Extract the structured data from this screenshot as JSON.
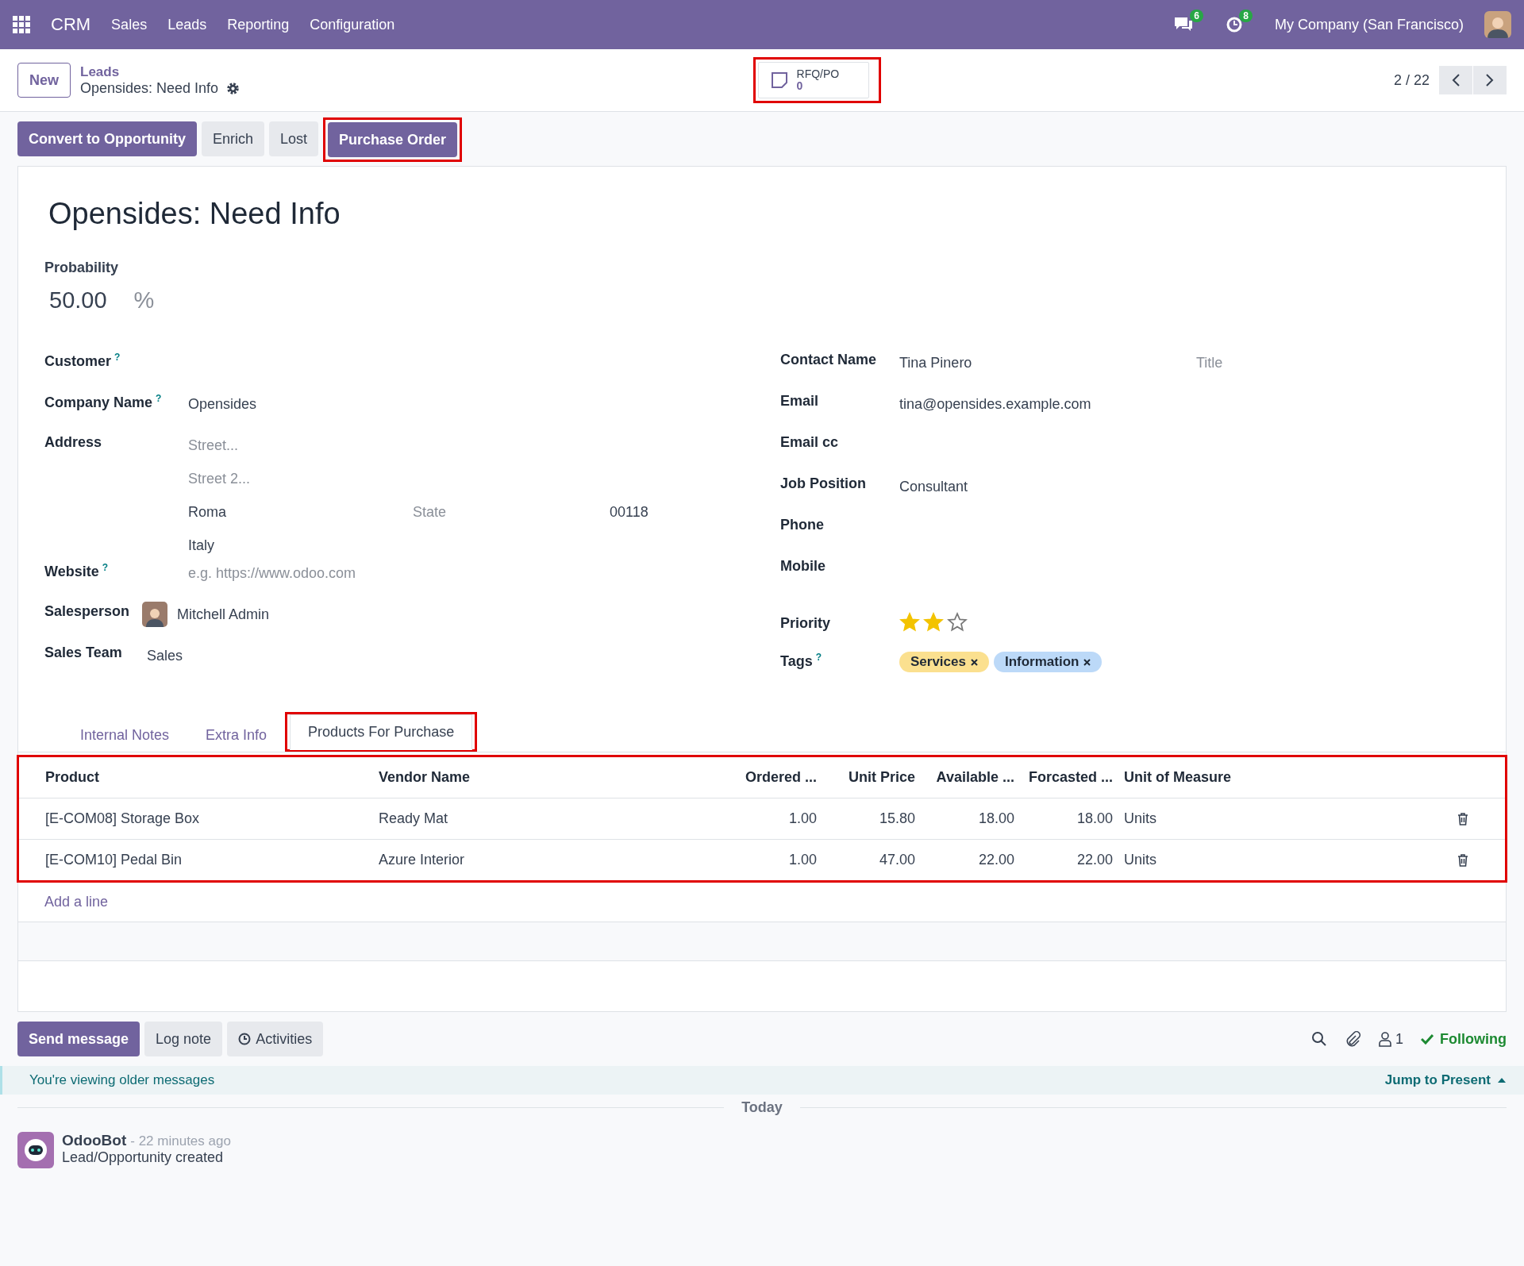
{
  "navbar": {
    "app": "CRM",
    "menus": [
      "Sales",
      "Leads",
      "Reporting",
      "Configuration"
    ],
    "messages_count": "6",
    "activities_count": "8",
    "company": "My Company (San Francisco)"
  },
  "control_panel": {
    "new_button": "New",
    "breadcrumb": "Leads",
    "record": "Opensides: Need Info",
    "smart_button": {
      "label": "RFQ/PO",
      "value": "0",
      "highlighted": true
    },
    "pager": "2 / 22"
  },
  "actions": [
    {
      "label": "Convert to Opportunity",
      "primary": true,
      "highlighted": false
    },
    {
      "label": "Enrich",
      "primary": false,
      "highlighted": false
    },
    {
      "label": "Lost",
      "primary": false,
      "highlighted": false
    },
    {
      "label": "Purchase Order",
      "primary": true,
      "highlighted": true
    }
  ],
  "form": {
    "title": "Opensides: Need Info",
    "probability": {
      "label": "Probability",
      "value": "50.00",
      "unit": "%"
    },
    "left_fields": [
      {
        "kind": "text",
        "label": "Customer",
        "help": "?"
      },
      {
        "kind": "text",
        "label": "Company Name",
        "help": "?",
        "value": "Opensides"
      },
      {
        "kind": "address",
        "label": "Address",
        "street": {
          "placeholder": "Street..."
        },
        "street2": {
          "placeholder": "Street 2..."
        },
        "city": "Roma",
        "state": {
          "placeholder": "State"
        },
        "zip": "00118",
        "country": "Italy"
      },
      {
        "kind": "text",
        "label": "Website",
        "help": "?",
        "placeholder": "e.g. https://www.odoo.com"
      },
      {
        "kind": "user",
        "label": "Salesperson",
        "value": "Mitchell Admin"
      },
      {
        "kind": "text",
        "label": "Sales Team",
        "value": "Sales"
      }
    ],
    "right_fields": [
      {
        "kind": "contact",
        "label": "Contact Name",
        "value": "Tina Pinero",
        "title": {
          "placeholder": "Title"
        }
      },
      {
        "kind": "text",
        "label": "Email",
        "value": "tina@opensides.example.com"
      },
      {
        "kind": "text",
        "label": "Email cc"
      },
      {
        "kind": "text",
        "label": "Job Position",
        "value": "Consultant"
      },
      {
        "kind": "text",
        "label": "Phone"
      },
      {
        "kind": "text",
        "label": "Mobile"
      },
      {
        "kind": "stars",
        "label": "Priority",
        "stars": 2
      },
      {
        "kind": "tags",
        "label": "Tags",
        "help": "?",
        "tags": [
          {
            "label": "Services",
            "color": "#fbe08f"
          },
          {
            "label": "Information",
            "color": "#bcd9f8"
          }
        ]
      }
    ],
    "tabs": [
      {
        "label": "Internal Notes",
        "selected": false,
        "highlighted": false
      },
      {
        "label": "Extra Info",
        "selected": false,
        "highlighted": false
      },
      {
        "label": "Products For Purchase",
        "selected": true,
        "highlighted": true
      }
    ],
    "table": {
      "highlighted": true,
      "columns": [
        "Product",
        "Vendor Name",
        "Ordered ...",
        "Unit Price",
        "Available ...",
        "Forcasted ...",
        "Unit of Measure"
      ],
      "rows": [
        {
          "cells": [
            "[E-COM08] Storage Box",
            "Ready Mat",
            "1.00",
            "15.80",
            "18.00",
            "18.00",
            "Units"
          ]
        },
        {
          "cells": [
            "[E-COM10] Pedal Bin",
            "Azure Interior",
            "1.00",
            "47.00",
            "22.00",
            "22.00",
            "Units"
          ]
        }
      ],
      "add_line": "Add a line"
    }
  },
  "chatter": {
    "buttons": [
      {
        "label": "Send message",
        "kind": "primary"
      },
      {
        "label": "Log note",
        "kind": "plain"
      },
      {
        "label": "Activities",
        "kind": "activities"
      }
    ],
    "followers": "1",
    "following": "Following",
    "banner": "You're viewing older messages",
    "jump": "Jump to Present",
    "divider": "Today",
    "messages": [
      {
        "author": "OdooBot",
        "time": "- 22 minutes ago",
        "body": "Lead/Opportunity created"
      }
    ]
  }
}
